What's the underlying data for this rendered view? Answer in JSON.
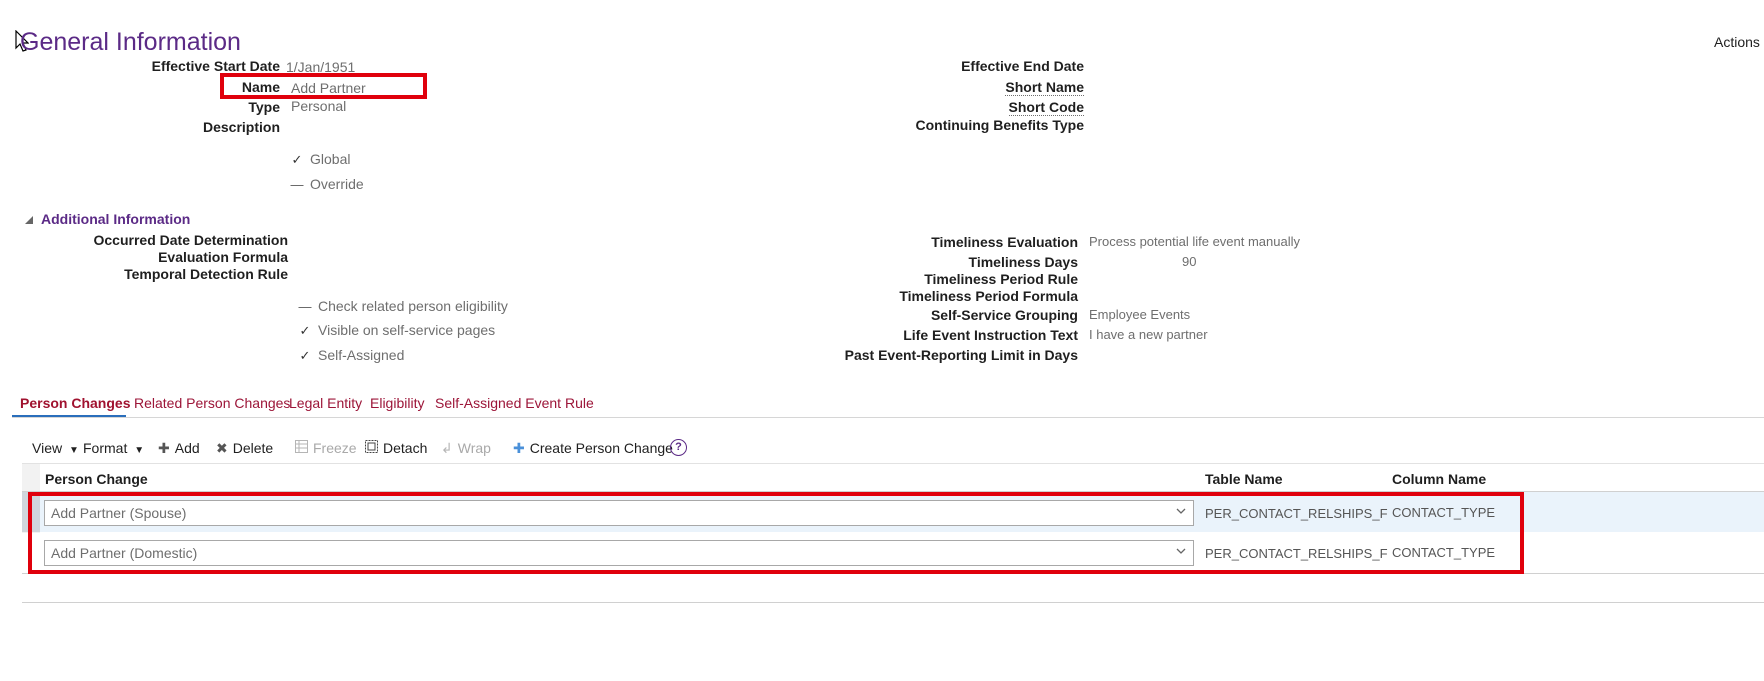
{
  "header": {
    "title": "General Information",
    "actions_label": "Actions"
  },
  "general": {
    "effective_start_date": {
      "label": "Effective Start Date",
      "value": "1/Jan/1951"
    },
    "name": {
      "label": "Name",
      "value": "Add Partner"
    },
    "type": {
      "label": "Type",
      "value": "Personal"
    },
    "description": {
      "label": "Description",
      "value": ""
    },
    "global": {
      "label": "Global",
      "checked": true
    },
    "override": {
      "label": "Override",
      "checked": false
    },
    "effective_end_date": {
      "label": "Effective End Date",
      "value": ""
    },
    "short_name": {
      "label": "Short Name",
      "value": ""
    },
    "short_code": {
      "label": "Short Code",
      "value": ""
    },
    "continuing_benefits_type": {
      "label": "Continuing Benefits Type",
      "value": ""
    }
  },
  "additional": {
    "section_title": "Additional Information",
    "occurred_date_determination": {
      "label": "Occurred Date Determination",
      "value": ""
    },
    "evaluation_formula": {
      "label": "Evaluation Formula",
      "value": ""
    },
    "temporal_detection_rule": {
      "label": "Temporal Detection Rule",
      "value": ""
    },
    "check_related": {
      "label": "Check related person eligibility",
      "checked": false
    },
    "visible_self_service": {
      "label": "Visible on self-service pages",
      "checked": true
    },
    "self_assigned": {
      "label": "Self-Assigned",
      "checked": true
    },
    "timeliness_evaluation": {
      "label": "Timeliness Evaluation",
      "value": "Process potential life event manually"
    },
    "timeliness_days": {
      "label": "Timeliness Days",
      "value": "90"
    },
    "timeliness_period_rule": {
      "label": "Timeliness Period Rule",
      "value": ""
    },
    "timeliness_period_formula": {
      "label": "Timeliness Period Formula",
      "value": ""
    },
    "self_service_grouping": {
      "label": "Self-Service Grouping",
      "value": "Employee Events"
    },
    "life_event_instruction_text": {
      "label": "Life Event Instruction Text",
      "value": "I have a new partner"
    },
    "past_event_reporting_limit": {
      "label": "Past Event-Reporting Limit in Days",
      "value": ""
    }
  },
  "tabs": [
    {
      "label": "Person Changes",
      "active": true
    },
    {
      "label": "Related Person Changes",
      "active": false
    },
    {
      "label": "Legal Entity",
      "active": false
    },
    {
      "label": "Eligibility",
      "active": false
    },
    {
      "label": "Self-Assigned Event Rule",
      "active": false
    }
  ],
  "toolbar": {
    "view": "View",
    "format": "Format",
    "add": "Add",
    "delete": "Delete",
    "freeze": "Freeze",
    "detach": "Detach",
    "wrap": "Wrap",
    "create_person_change": "Create Person Change",
    "help": "?"
  },
  "table": {
    "columns": [
      "Person Change",
      "Table Name",
      "Column Name"
    ],
    "rows": [
      {
        "person_change": "Add Partner (Spouse)",
        "table_name": "PER_CONTACT_RELSHIPS_F",
        "column_name": "CONTACT_TYPE"
      },
      {
        "person_change": "Add Partner (Domestic)",
        "table_name": "PER_CONTACT_RELSHIPS_F",
        "column_name": "CONTACT_TYPE"
      }
    ]
  },
  "colors": {
    "title": "#5b2a86",
    "tab_active": "#a0122f",
    "highlight": "#e0000c",
    "selected_row": "#eaf3fb"
  }
}
